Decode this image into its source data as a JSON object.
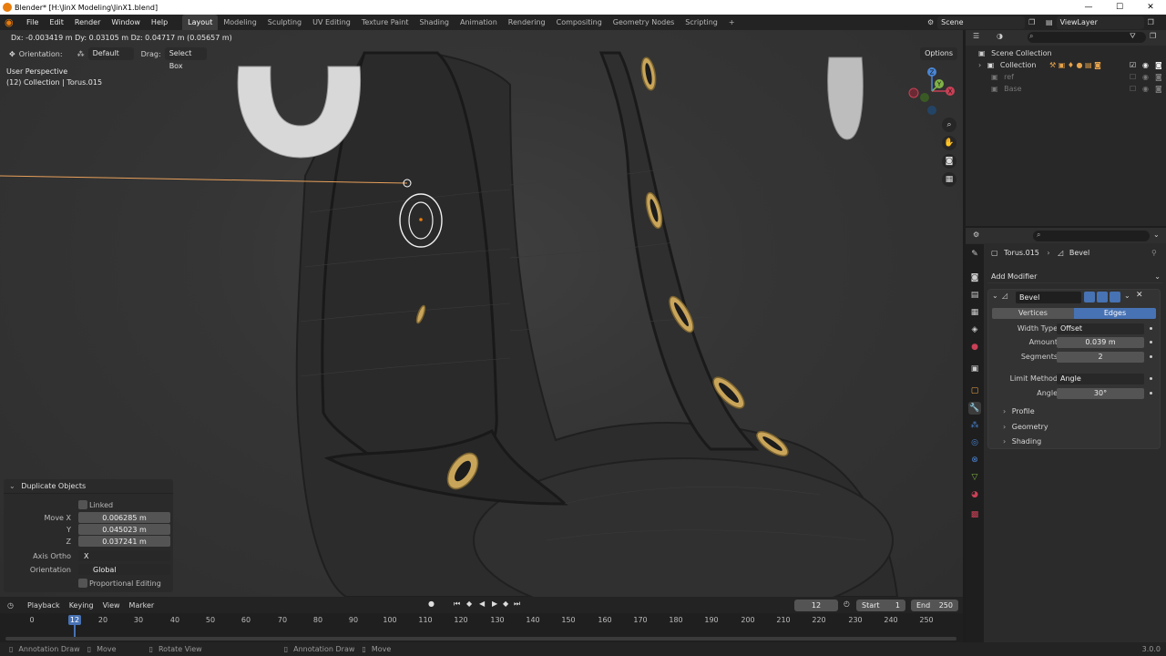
{
  "window": {
    "title": "Blender* [H:\\JinX Modeling\\JinX1.blend]",
    "minimize": "—",
    "maximize": "☐",
    "close": "✕"
  },
  "topbar": {
    "menus": [
      "File",
      "Edit",
      "Render",
      "Window",
      "Help"
    ],
    "workspaces": [
      "Layout",
      "Modeling",
      "Sculpting",
      "UV Editing",
      "Texture Paint",
      "Shading",
      "Animation",
      "Rendering",
      "Compositing",
      "Geometry Nodes",
      "Scripting"
    ],
    "active_workspace": "Layout",
    "add_workspace": "+",
    "scene": "Scene",
    "view_layer": "ViewLayer"
  },
  "viewport": {
    "status": "Dx: -0.003419 m  Dy: 0.03105 m  Dz: 0.04717 m (0.05657 m)",
    "orientation_label": "Orientation:",
    "orientation_value": "Default",
    "drag_label": "Drag:",
    "drag_value": "Select Box",
    "options": "Options",
    "view_name": "User Perspective",
    "collection_info": "(12) Collection | Torus.015",
    "gizmo": {
      "x": "X",
      "y": "Y",
      "z": "Z"
    }
  },
  "redo_panel": {
    "title": "Duplicate Objects",
    "linked": "Linked",
    "move_x_label": "Move X",
    "move_x": "0.006285 m",
    "y_label": "Y",
    "y": "0.045023 m",
    "z_label": "Z",
    "z": "0.037241 m",
    "axis_ortho_label": "Axis Ortho",
    "axis_ortho": "X",
    "orientation_label": "Orientation",
    "orientation": "Global",
    "proportional": "Proportional Editing"
  },
  "timeline": {
    "menus": [
      "Playback",
      "Keying",
      "View",
      "Marker"
    ],
    "current_frame": "12",
    "start_label": "Start",
    "start": "1",
    "end_label": "End",
    "end": "250",
    "ticks": [
      "0",
      "20",
      "30",
      "40",
      "50",
      "60",
      "70",
      "80",
      "90",
      "100",
      "110",
      "120",
      "130",
      "140",
      "150",
      "160",
      "170",
      "180",
      "190",
      "200",
      "210",
      "220",
      "230",
      "240",
      "250"
    ],
    "cursor_label": "12"
  },
  "statusbar": {
    "items": [
      "Annotation Draw",
      "Move",
      "Rotate View",
      "Annotation Draw",
      "Move"
    ],
    "version": "3.0.0"
  },
  "outliner": {
    "scene_collection": "Scene Collection",
    "items": [
      "Collection",
      "ref",
      "Base"
    ]
  },
  "properties": {
    "object": "Torus.015",
    "modifier": "Bevel",
    "add_modifier": "Add Modifier",
    "modifier_name": "Bevel",
    "affect_vertices": "Vertices",
    "affect_edges": "Edges",
    "width_type_label": "Width Type",
    "width_type": "Offset",
    "amount_label": "Amount",
    "amount": "0.039 m",
    "segments_label": "Segments",
    "segments": "2",
    "limit_method_label": "Limit Method",
    "limit_method": "Angle",
    "angle_label": "Angle",
    "angle": "30°",
    "subpanels": [
      "Profile",
      "Geometry",
      "Shading"
    ]
  },
  "colors": {
    "accent": "#4772b3",
    "active_object": "#e87d0d",
    "mesh": "#2d2d2d",
    "grommet": "#c9a55a"
  }
}
